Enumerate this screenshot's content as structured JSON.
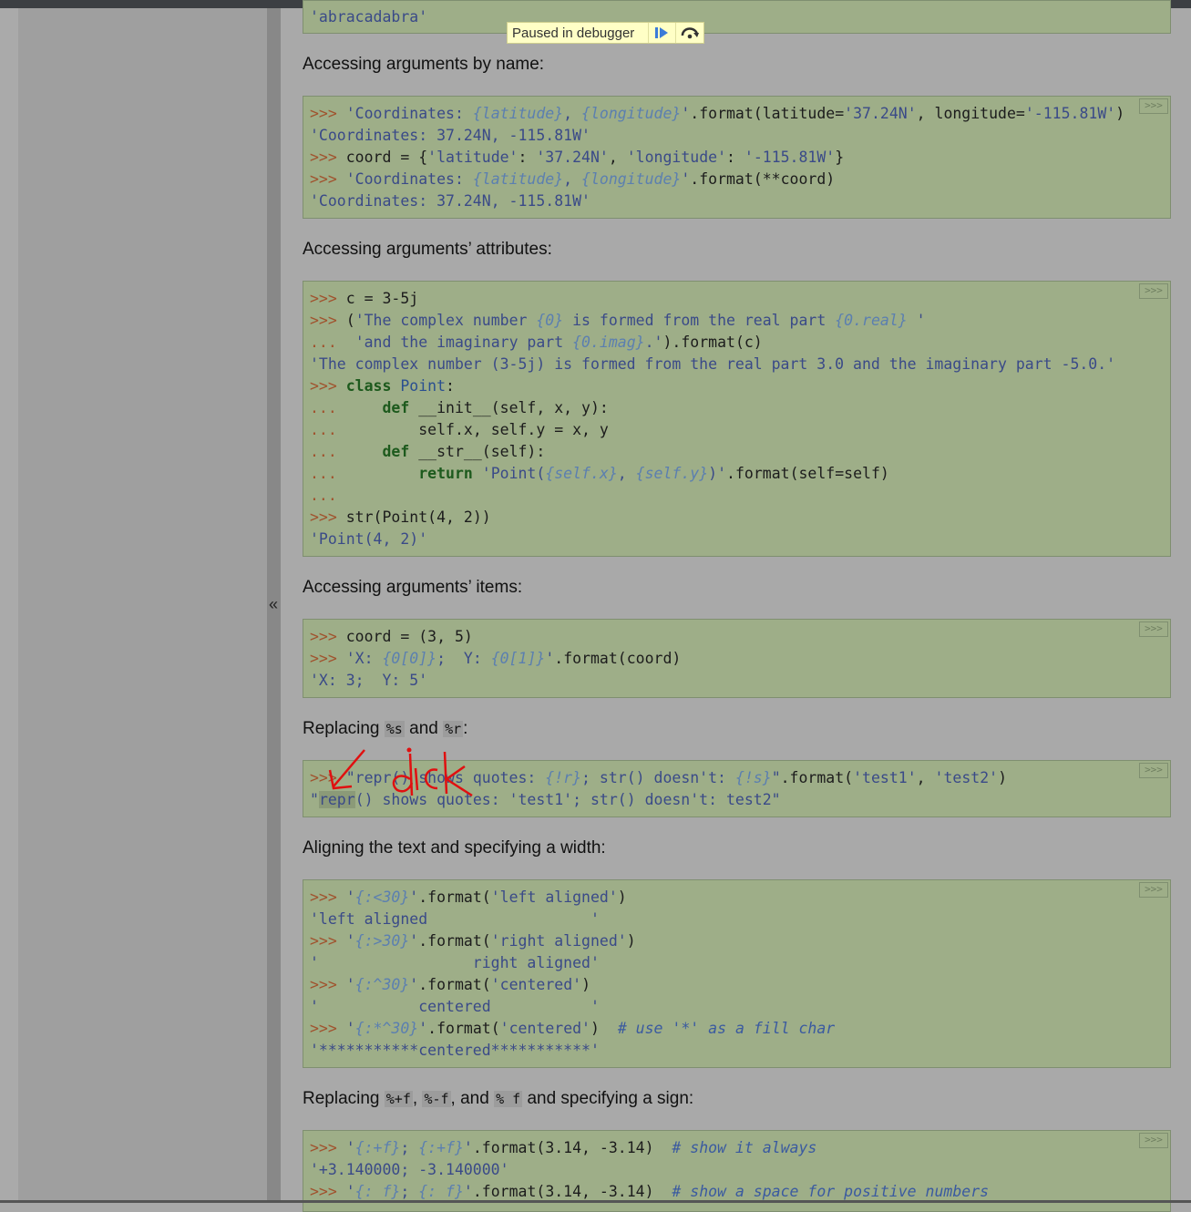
{
  "debugger": {
    "message": "Paused in debugger",
    "resume_icon": "resume-icon",
    "step_over_icon": "step-over-icon"
  },
  "sidebar": {
    "collapse_label": "«"
  },
  "copy_label": ">>>",
  "headings": {
    "by_name": "Accessing arguments by name:",
    "attributes": "Accessing arguments’ attributes:",
    "items": "Accessing arguments’ items:",
    "replacing_prefix": "Replacing ",
    "replacing_s": "%s",
    "replacing_and": " and ",
    "replacing_r": "%r",
    "replacing_colon": ":",
    "aligning": "Aligning the text and specifying a width:",
    "sign_prefix": "Replacing ",
    "sign_f1": "%+f",
    "sign_comma1": ", ",
    "sign_f2": "%-f",
    "sign_comma2": ", and ",
    "sign_f3": "% f",
    "sign_suffix": " and specifying a sign:"
  },
  "code": {
    "top_partial": "'abracadabra'",
    "by_name": [
      ">>> 'Coordinates: {latitude}, {longitude}'.format(latitude='37.24N', longitude='-115.81W')",
      "'Coordinates: 37.24N, -115.81W'",
      ">>> coord = {'latitude': '37.24N', 'longitude': '-115.81W'}",
      ">>> 'Coordinates: {latitude}, {longitude}'.format(**coord)",
      "'Coordinates: 37.24N, -115.81W'"
    ],
    "attributes": [
      ">>> c = 3-5j",
      ">>> ('The complex number {0} is formed from the real part {0.real} '",
      "...  'and the imaginary part {0.imag}.').format(c)",
      "'The complex number (3-5j) is formed from the real part 3.0 and the imaginary part -5.0.'",
      ">>> class Point:",
      "...     def __init__(self, x, y):",
      "...         self.x, self.y = x, y",
      "...     def __str__(self):",
      "...         return 'Point({self.x}, {self.y})'.format(self=self)",
      "...",
      ">>> str(Point(4, 2))",
      "'Point(4, 2)'"
    ],
    "items": [
      ">>> coord = (3, 5)",
      ">>> 'X: {0[0]};  Y: {0[1]}'.format(coord)",
      "'X: 3;  Y: 5'"
    ],
    "repr": [
      ">>> \"repr() shows quotes: {!r}; str() doesn't: {!s}\".format('test1', 'test2')",
      "\"repr() shows quotes: 'test1'; str() doesn't: test2\""
    ],
    "aligning": [
      ">>> '{:<30}'.format('left aligned')",
      "'left aligned                  '",
      ">>> '{:>30}'.format('right aligned')",
      "'                 right aligned'",
      ">>> '{:^30}'.format('centered')",
      "'           centered           '",
      ">>> '{:*^30}'.format('centered')  # use '*' as a fill char",
      "'***********centered***********'"
    ],
    "sign": [
      ">>> '{:+f}; {:+f}'.format(3.14, -3.14)  # show it always",
      "'+3.140000; -3.140000'",
      ">>> '{: f}; {: f}'.format(3.14, -3.14)  # show a space for positive numbers"
    ]
  },
  "annotation": {
    "handwriting": "dick"
  }
}
